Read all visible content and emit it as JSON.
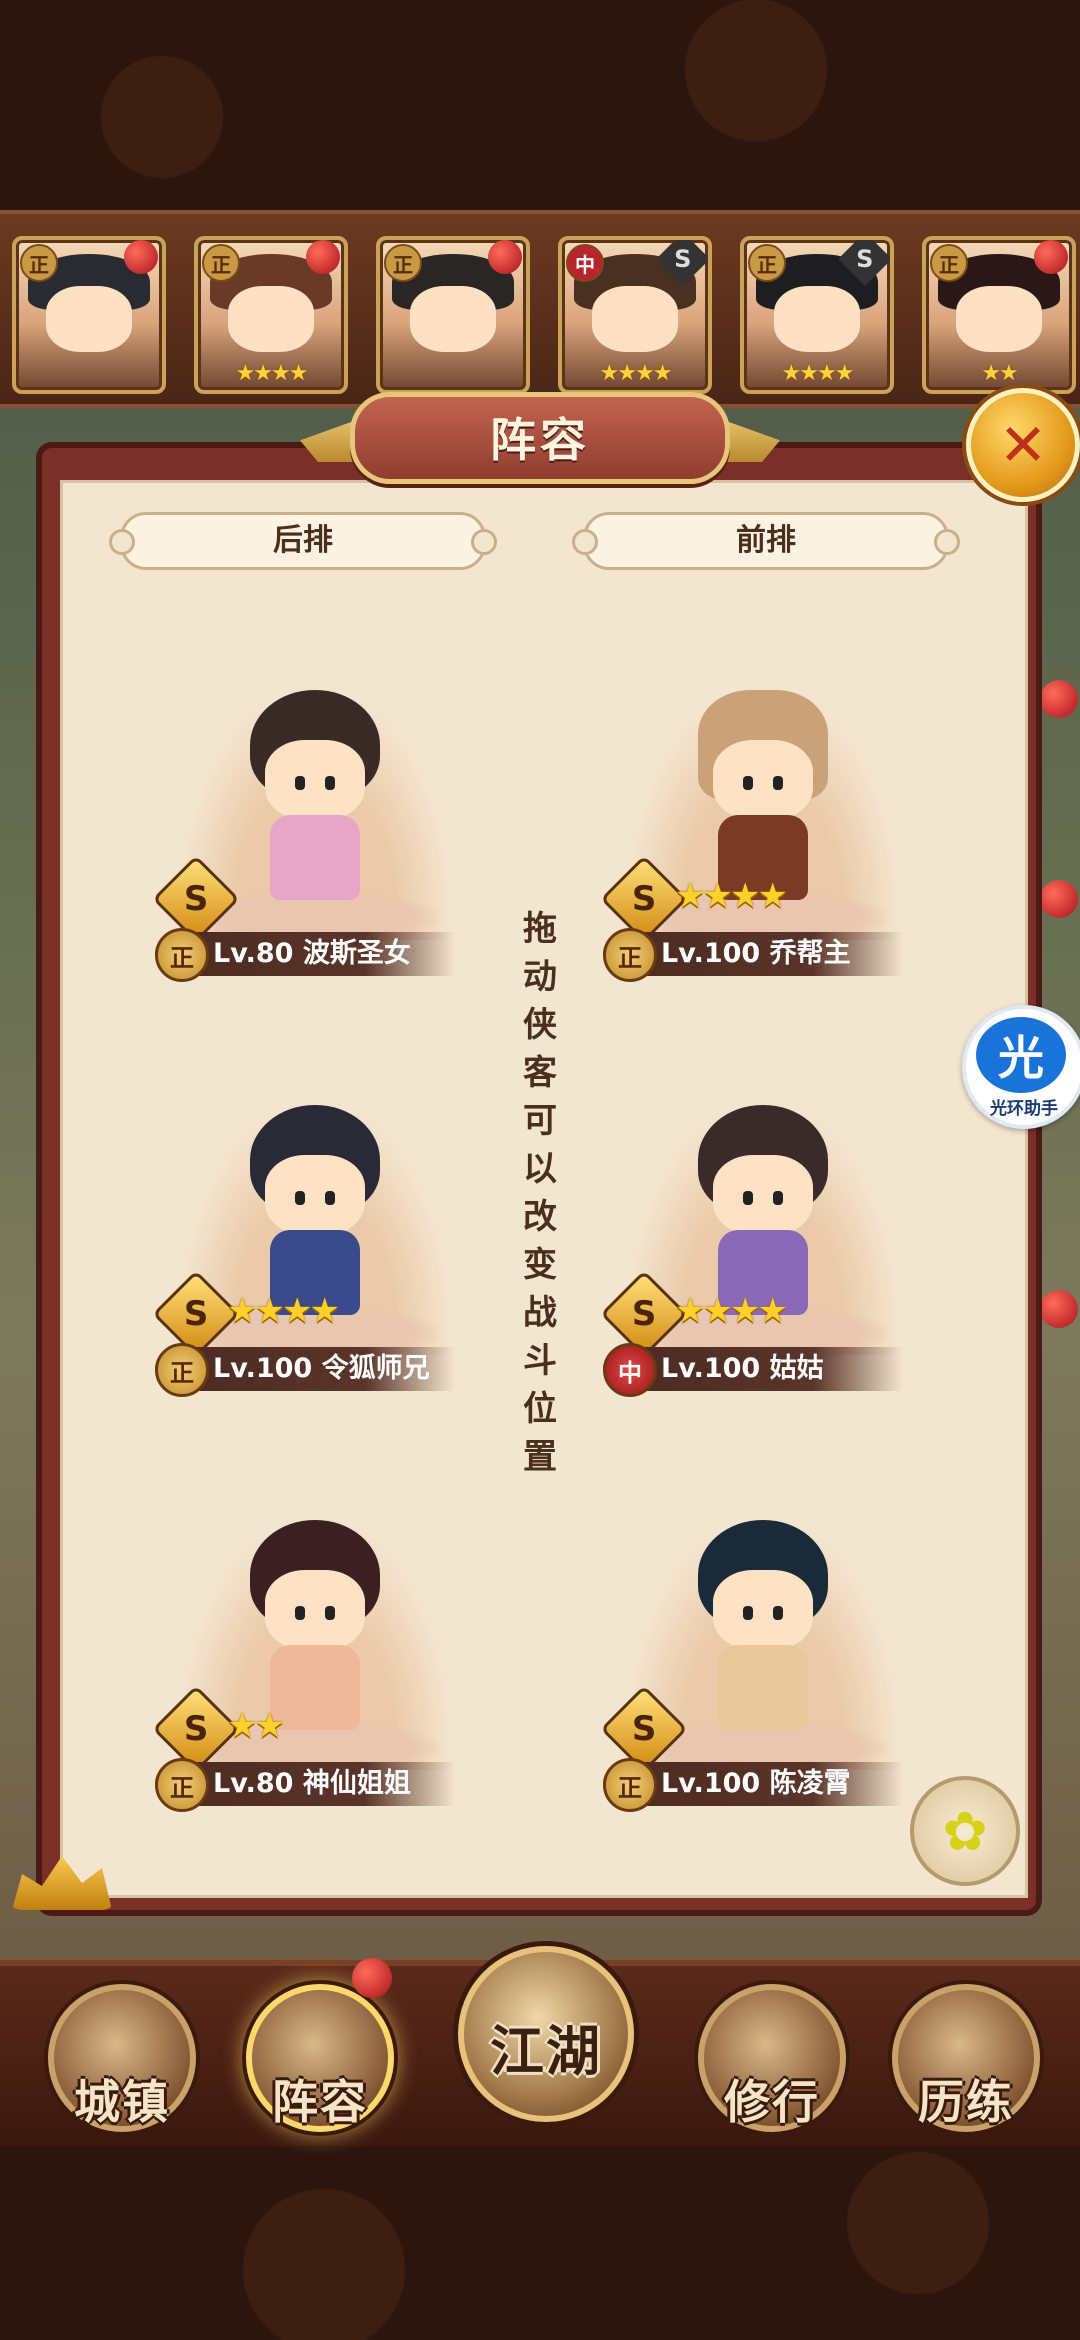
{
  "roster": [
    {
      "badge": "正",
      "stars": "",
      "marker": "dot"
    },
    {
      "badge": "正",
      "stars": "★★★★",
      "marker": "dot"
    },
    {
      "badge": "正",
      "stars": "",
      "marker": "dot"
    },
    {
      "badge": "中",
      "stars": "★★★★",
      "marker": "s"
    },
    {
      "badge": "正",
      "stars": "★★★★",
      "marker": "s"
    },
    {
      "badge": "正",
      "stars": "★★",
      "marker": "dot"
    }
  ],
  "panel": {
    "title": "阵容",
    "close_icon": "✕",
    "col_back": "后排",
    "col_front": "前排",
    "hint": "拖动侠客可以改变战斗位置"
  },
  "heroes": [
    {
      "name": "Lv.80 波斯圣女",
      "badge": "正",
      "stars": "",
      "grade": "S",
      "hair": "#3a2a26",
      "body": "#e7a6c8"
    },
    {
      "name": "Lv.100 乔帮主",
      "badge": "正",
      "stars": "★★★★",
      "grade": "S",
      "hair": "#c9a27a",
      "body": "#7a3a26"
    },
    {
      "name": "Lv.100 令狐师兄",
      "badge": "正",
      "stars": "★★★★",
      "grade": "S",
      "hair": "#2a2a36",
      "body": "#3a4a8a"
    },
    {
      "name": "Lv.100 姑姑",
      "badge": "中",
      "stars": "★★★★",
      "grade": "S",
      "hair": "#3a2a2a",
      "body": "#8a6ab8"
    },
    {
      "name": "Lv.80 神仙姐姐",
      "badge": "正",
      "stars": "★★",
      "grade": "S",
      "hair": "#3a2020",
      "body": "#f0b89a"
    },
    {
      "name": "Lv.100 陈凌霄",
      "badge": "正",
      "stars": "",
      "grade": "S",
      "hair": "#1a2a36",
      "body": "#e8c89a"
    }
  ],
  "assistant": {
    "glyph": "光",
    "label": "光环助手"
  },
  "nav": {
    "town": "城镇",
    "lineup": "阵容",
    "jianghu": "江湖",
    "training": "修行",
    "trials": "历练"
  }
}
